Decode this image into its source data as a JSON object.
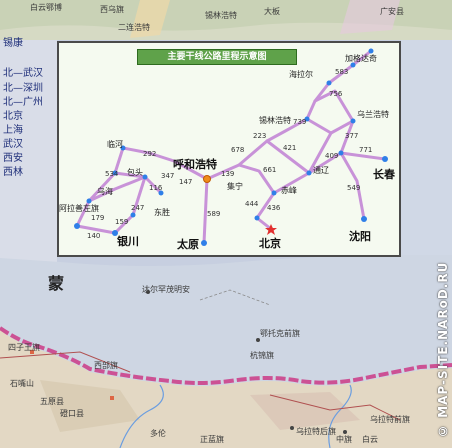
{
  "top_map_labels": [
    "白云鄂博",
    "西乌旗",
    "锡林浩特",
    "二连浩特",
    "大板",
    "广安县"
  ],
  "legend": {
    "left_cut_label": "锡康",
    "routes": [
      "北—武汉",
      "北—深圳",
      "北—广州",
      "北京",
      "上海",
      "武汉",
      "西安",
      "西林"
    ]
  },
  "inset": {
    "title": "主要干线公路里程示意图",
    "cities": {
      "hohhot": "呼和浩特",
      "beijing": "北京",
      "taiyuan": "太原",
      "yinchuan": "银川",
      "shenyang": "沈阳",
      "changchun": "长春"
    },
    "minor_cities": {
      "hailar": "海拉尔",
      "manzhouli": "加格达奇",
      "ulanhot": "乌兰浩特",
      "xilinhot": "锡林浩特",
      "tongliao": "通辽",
      "chifeng": "赤峰",
      "jining": "集宁",
      "baotou": "包头",
      "dongsheng": "东胜",
      "linhe": "临河",
      "wuhai": "乌海",
      "alxa": "阿拉善左旗"
    },
    "distances": [
      "292",
      "534",
      "116",
      "147",
      "139",
      "678",
      "661",
      "421",
      "739",
      "756",
      "583",
      "377",
      "409",
      "771",
      "549",
      "436",
      "444",
      "589",
      "247",
      "159",
      "179",
      "140",
      "347",
      "223"
    ]
  },
  "region_label": "蒙",
  "bottom_labels": [
    "达尔罕茂明安",
    "鄂托克前旗",
    "杭锦旗",
    "乌拉特后旗",
    "中旗",
    "乌拉特前旗",
    "四子王旗",
    "多伦",
    "正蓝旗",
    "五原县",
    "磴口县",
    "石嘴山",
    "西部旗",
    "白云"
  ],
  "watermark": "© MAP-SITE.NARoD.RU",
  "colors": {
    "route": "#c892d8",
    "node": "#2f7fe8",
    "capital": "#e23030",
    "border": "#cc2f80",
    "inset_bg": "#f5faf0"
  }
}
